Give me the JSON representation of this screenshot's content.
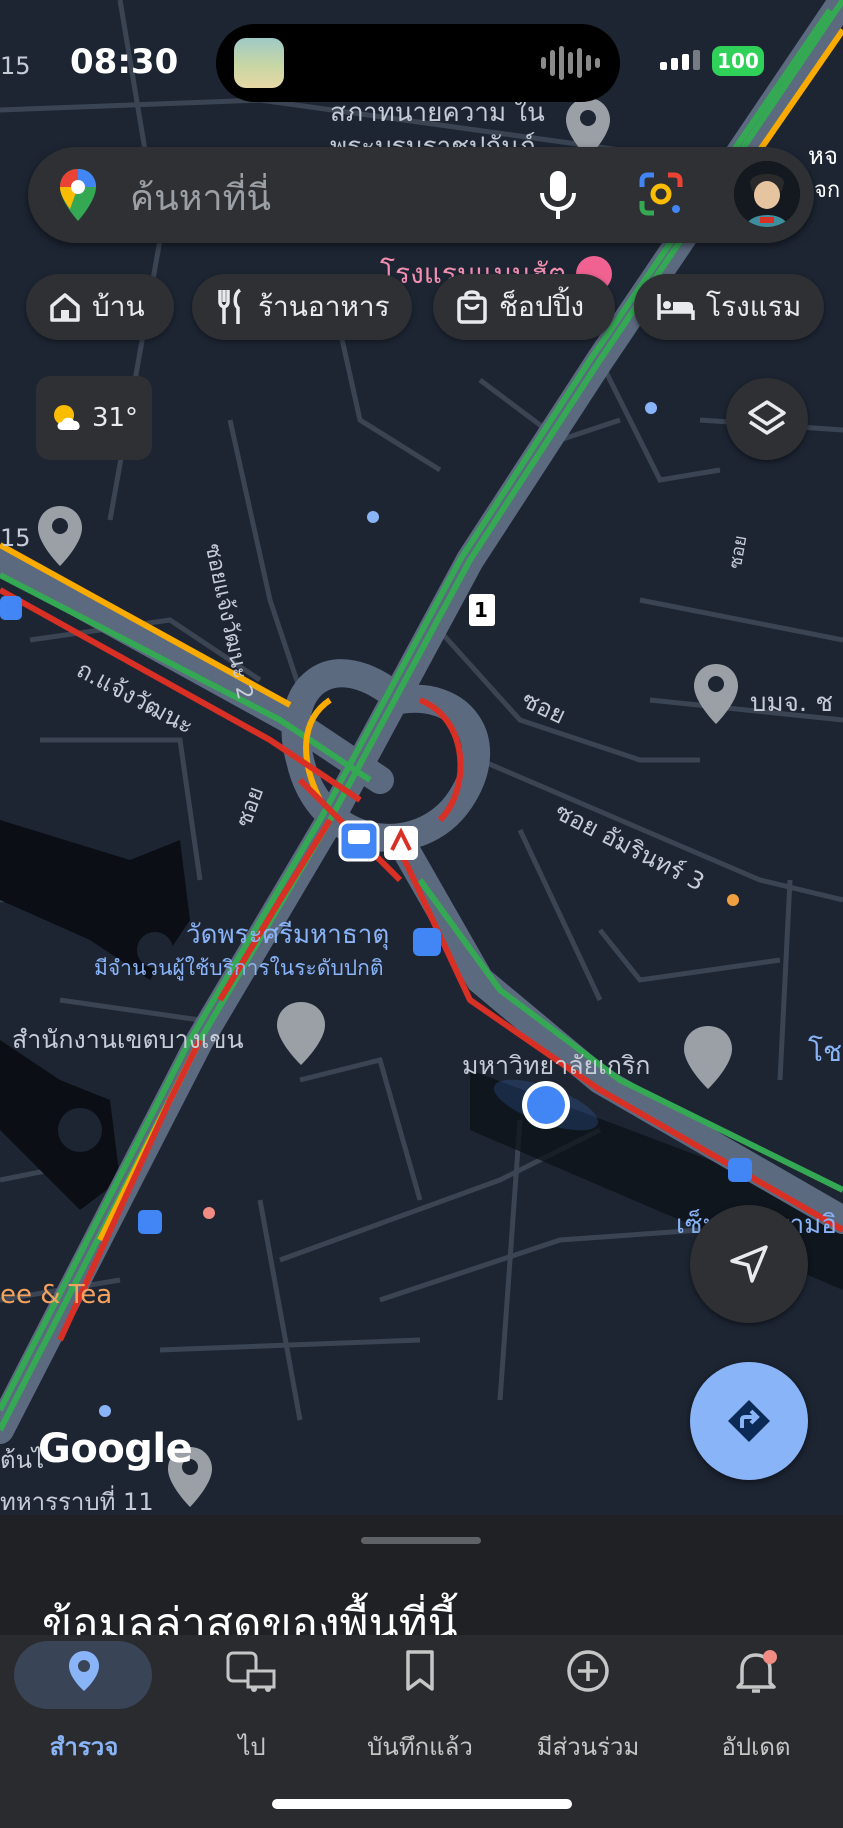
{
  "status_bar": {
    "time": "08:30",
    "battery": "100"
  },
  "search": {
    "placeholder": "ค้นหาที่นี่"
  },
  "chips": [
    {
      "label": "บ้าน",
      "icon": "home-icon"
    },
    {
      "label": "ร้านอาหาร",
      "icon": "restaurant-icon"
    },
    {
      "label": "ช็อปปิ้ง",
      "icon": "shopping-bag-icon"
    },
    {
      "label": "โรงแรม",
      "icon": "hotel-icon"
    }
  ],
  "weather": {
    "temperature": "31°",
    "icon": "partly-sunny-icon"
  },
  "map": {
    "labels": {
      "top_label_1": "สภาทนายความ ใน",
      "top_label_2": "พระบรมราชูปถัมภ์",
      "hotel_partial": "โรงแรมแมนฮัต",
      "partial_right_top": "หจ",
      "partial_right_top2": "จก",
      "corner_15_top": "15",
      "corner_15_mid": "15",
      "soi_jaeng_2": "ซอยแจ้งวัฒนะ 2",
      "road_jaeng": "ถ.แจ้งวัฒนะ",
      "soi_a": "ซอย",
      "soi_b": "ซอย",
      "soi_c": "ซอย",
      "soi_amarin": "ซอย อัมรินทร์ 3",
      "bomjo": "บมจ. ช",
      "wat_name": "วัดพระศรีมหาธาตุ",
      "wat_busy": "มีจำนวนผู้ใช้บริการในระดับปกติ",
      "district_office": "สำนักงานเขตบางเขน",
      "university": "มหาวิทยาลัยเกริก",
      "partial_right_mid": "โช",
      "central_partial": "เซ็นทรัล รามอิ",
      "coffee_tea": "ee & Tea",
      "bottom_left_1": "ต้นไ",
      "bottom_left_2": "ทหารราบที่ 11",
      "route_shield": "1"
    }
  },
  "attribution": "Google",
  "sheet": {
    "title": "ข้อมูลล่าสุดของพื้นที่นี้"
  },
  "bottom_nav": [
    {
      "label": "สำรวจ",
      "icon": "explore-pin-icon",
      "active": true
    },
    {
      "label": "ไป",
      "icon": "commute-icon",
      "active": false
    },
    {
      "label": "บันทึกแล้ว",
      "icon": "bookmark-icon",
      "active": false
    },
    {
      "label": "มีส่วนร่วม",
      "icon": "add-circle-icon",
      "active": false
    },
    {
      "label": "อัปเดต",
      "icon": "bell-icon",
      "active": false
    }
  ],
  "colors": {
    "traffic_green": "#34a853",
    "traffic_orange": "#f9ab00",
    "traffic_red": "#d93025",
    "accent_blue": "#8ab4f8",
    "location_blue": "#4285f4"
  }
}
